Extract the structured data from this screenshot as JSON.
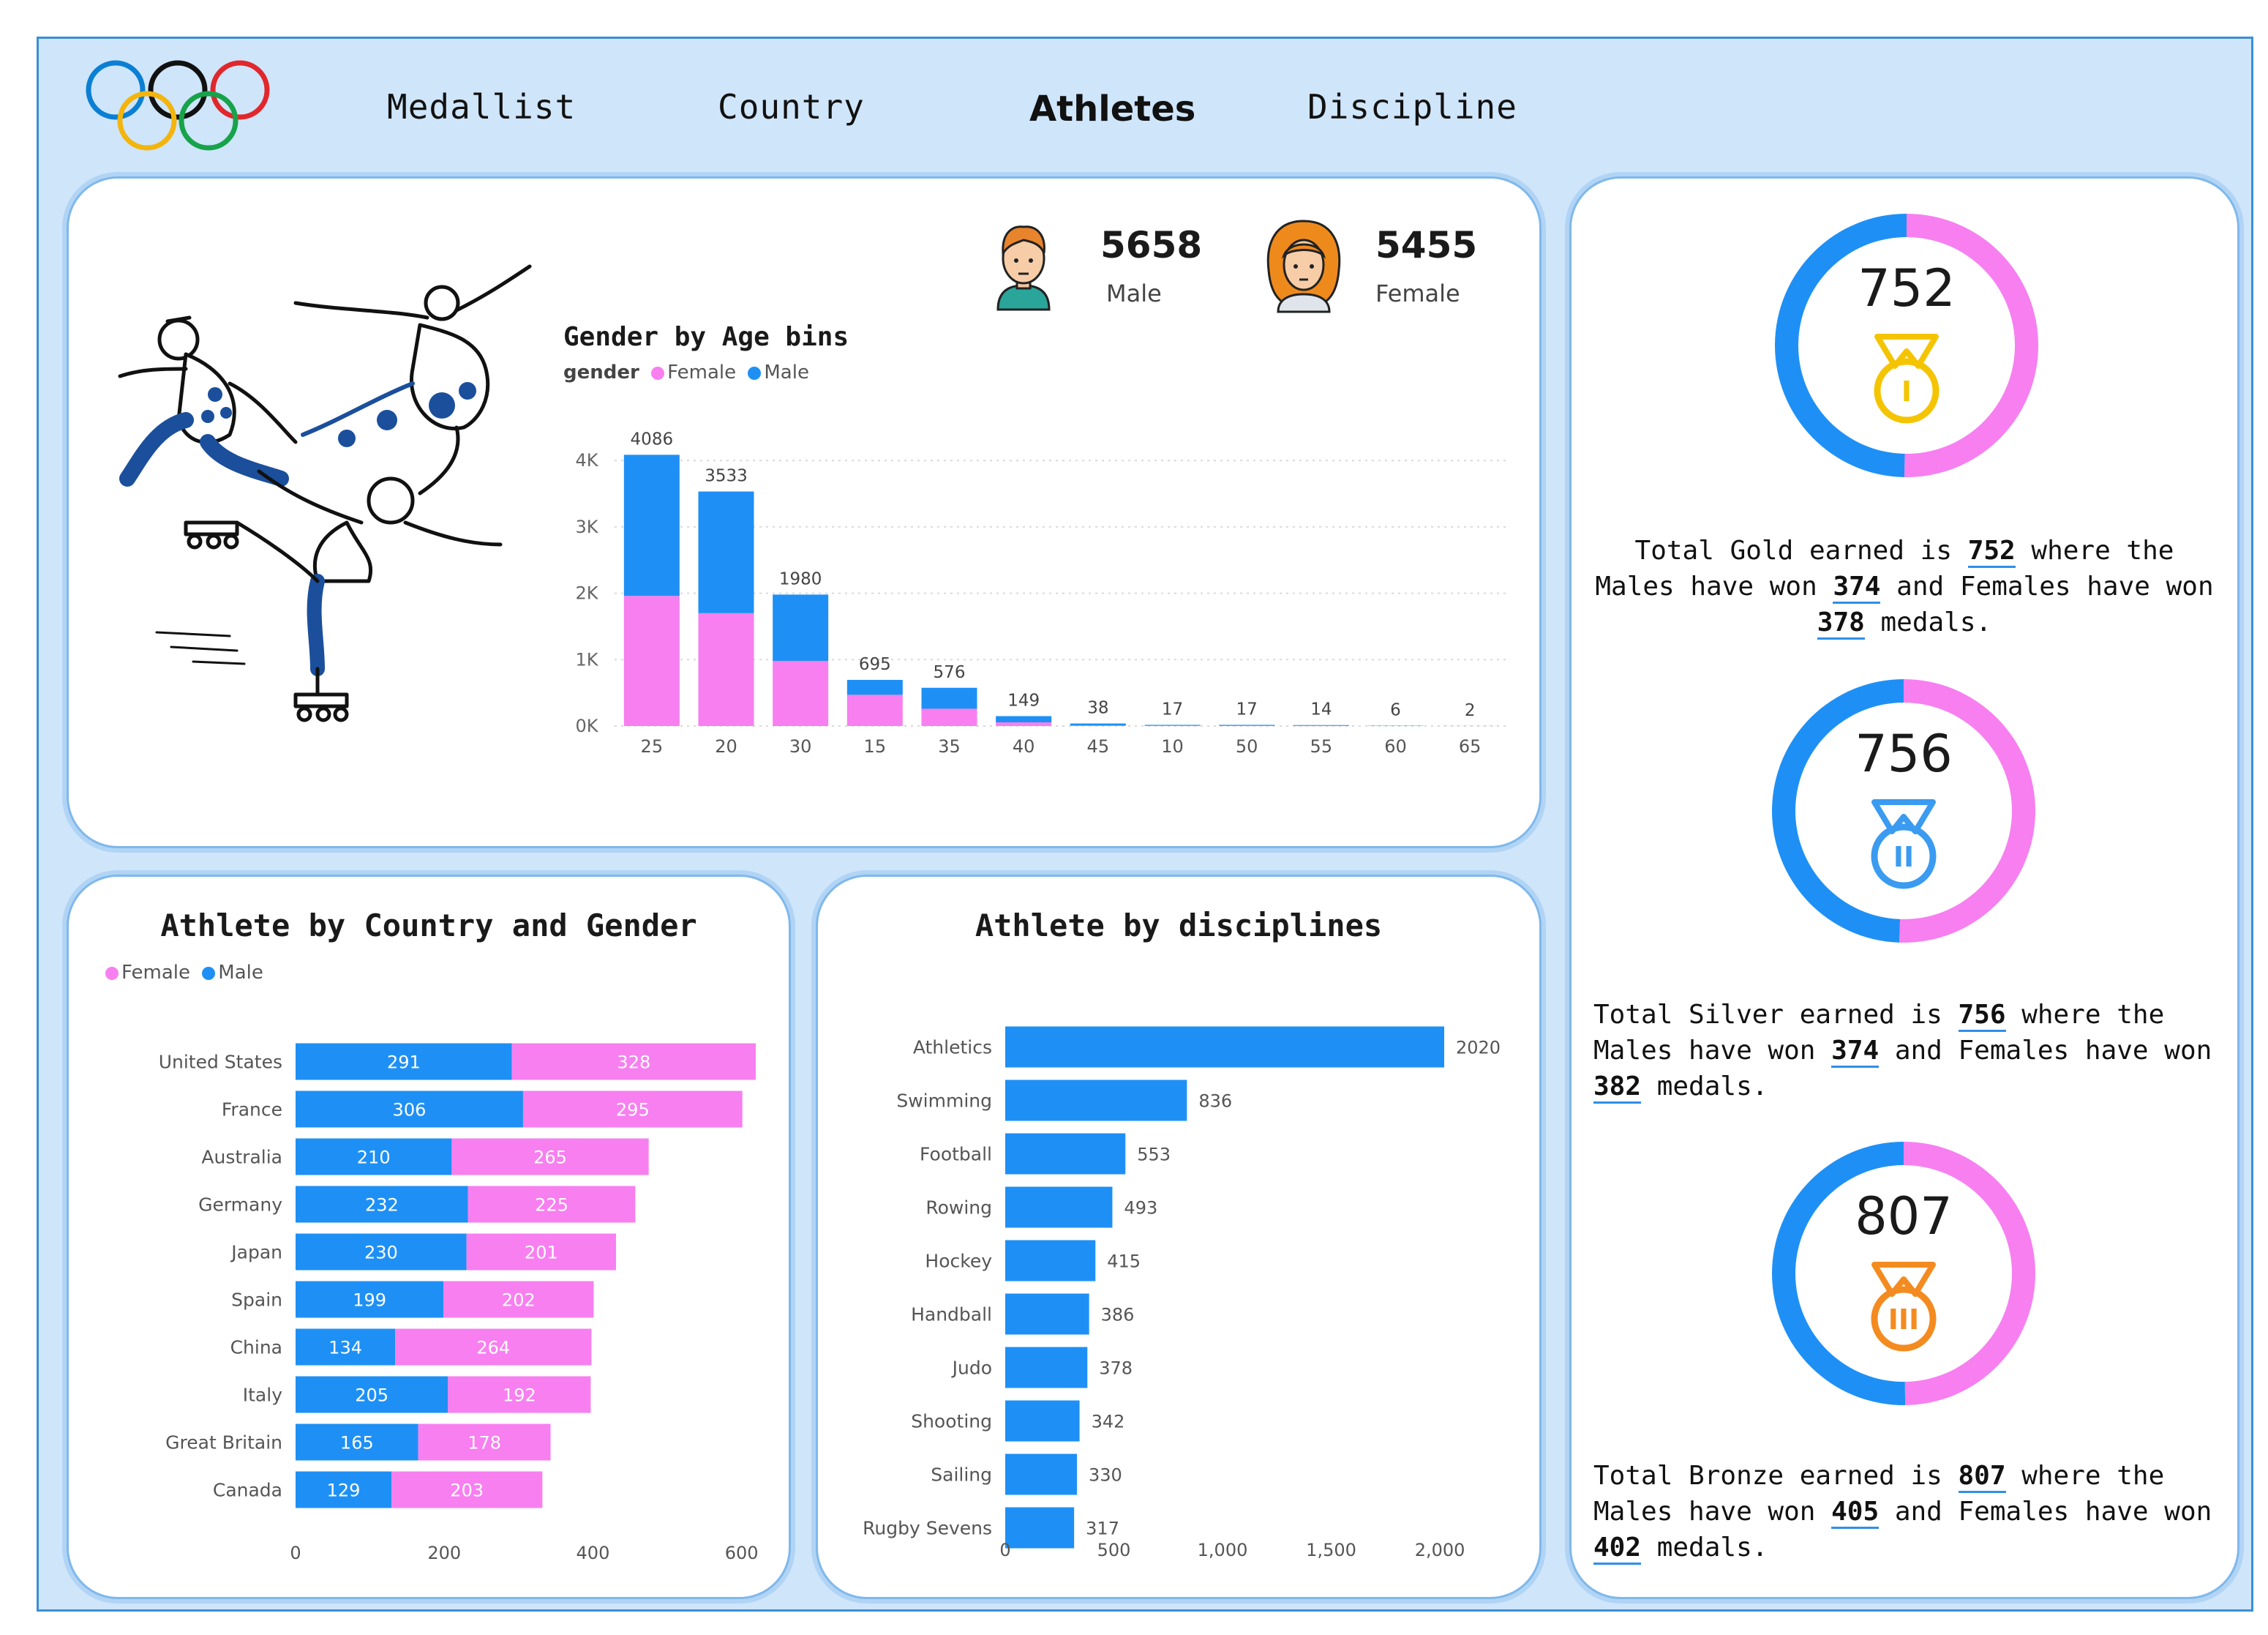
{
  "nav": {
    "items": [
      "Medallist",
      "Country",
      "Athletes",
      "Discipline"
    ],
    "active": "Athletes"
  },
  "colors": {
    "male": "#1e90f5",
    "female": "#f77ff0",
    "frame_bg": "#cfe5fa",
    "gold": "#f5c400",
    "silver": "#3a9bf0",
    "bronze": "#f48b20"
  },
  "kpis": {
    "male_count": "5658",
    "male_label": "Male",
    "male_icon": "male-avatar-icon",
    "female_count": "5455",
    "female_label": "Female",
    "female_icon": "female-avatar-icon"
  },
  "age_chart": {
    "title": "Gender by Age bins",
    "legend_title": "gender",
    "legend": [
      "Female",
      "Male"
    ],
    "chart_data": {
      "type": "bar",
      "stacked": true,
      "categories": [
        "25",
        "20",
        "30",
        "15",
        "35",
        "40",
        "45",
        "10",
        "50",
        "55",
        "60",
        "65"
      ],
      "totals": [
        4086,
        3533,
        1980,
        695,
        576,
        149,
        38,
        17,
        17,
        14,
        6,
        2
      ],
      "series": [
        {
          "name": "Female",
          "values": [
            1960,
            1700,
            980,
            470,
            260,
            55,
            8,
            6,
            5,
            4,
            2,
            1
          ]
        },
        {
          "name": "Male",
          "values": [
            2126,
            1833,
            1000,
            225,
            316,
            94,
            30,
            11,
            12,
            10,
            4,
            1
          ]
        }
      ],
      "yticks": [
        "0K",
        "1K",
        "2K",
        "3K",
        "4K"
      ],
      "ylim": [
        0,
        4300
      ],
      "grid": true
    }
  },
  "country_chart": {
    "title": "Athlete by Country and Gender",
    "legend": [
      "Female",
      "Male"
    ],
    "chart_data": {
      "type": "bar",
      "orientation": "horizontal",
      "stacked": true,
      "categories": [
        "United States",
        "France",
        "Australia",
        "Germany",
        "Japan",
        "Spain",
        "China",
        "Italy",
        "Great Britain",
        "Canada"
      ],
      "series": [
        {
          "name": "Male",
          "values": [
            291,
            306,
            210,
            232,
            230,
            199,
            134,
            205,
            165,
            129
          ]
        },
        {
          "name": "Female",
          "values": [
            328,
            295,
            265,
            225,
            201,
            202,
            264,
            192,
            178,
            203
          ]
        }
      ],
      "xticks": [
        "0",
        "200",
        "400",
        "600"
      ],
      "xlim": [
        0,
        620
      ]
    }
  },
  "discipline_chart": {
    "title": "Athlete by disciplines",
    "chart_data": {
      "type": "bar",
      "orientation": "horizontal",
      "categories": [
        "Athletics",
        "Swimming",
        "Football",
        "Rowing",
        "Hockey",
        "Handball",
        "Judo",
        "Shooting",
        "Sailing",
        "Rugby Sevens"
      ],
      "values": [
        2020,
        836,
        553,
        493,
        415,
        386,
        378,
        342,
        330,
        317
      ],
      "xticks": [
        "0",
        "500",
        "1,000",
        "1,500",
        "2,000"
      ],
      "xlim": [
        0,
        2020
      ]
    }
  },
  "medals": [
    {
      "name": "Gold",
      "total": "752",
      "male": "374",
      "female": "378",
      "male_value": 374,
      "female_value": 378,
      "icon": "gold-medal-icon",
      "numeral": "I",
      "text_a": "Total Gold earned is ",
      "text_b": " where the",
      "text_c": "Males have won ",
      "text_d": " and Females have won",
      "text_e": " medals."
    },
    {
      "name": "Silver",
      "total": "756",
      "male": "374",
      "female": "382",
      "male_value": 374,
      "female_value": 382,
      "icon": "silver-medal-icon",
      "numeral": "II",
      "text_a": "Total Silver earned is ",
      "text_b": " where the",
      "text_c": "Males have won ",
      "text_d": " and Females have won",
      "text_e": " medals."
    },
    {
      "name": "Bronze",
      "total": "807",
      "male": "405",
      "female": "402",
      "male_value": 405,
      "female_value": 402,
      "icon": "bronze-medal-icon",
      "numeral": "III",
      "text_a": "Total Bronze earned is ",
      "text_b": " where the",
      "text_c": "Males have won ",
      "text_d": " and Females have won",
      "text_e": " medals."
    }
  ]
}
